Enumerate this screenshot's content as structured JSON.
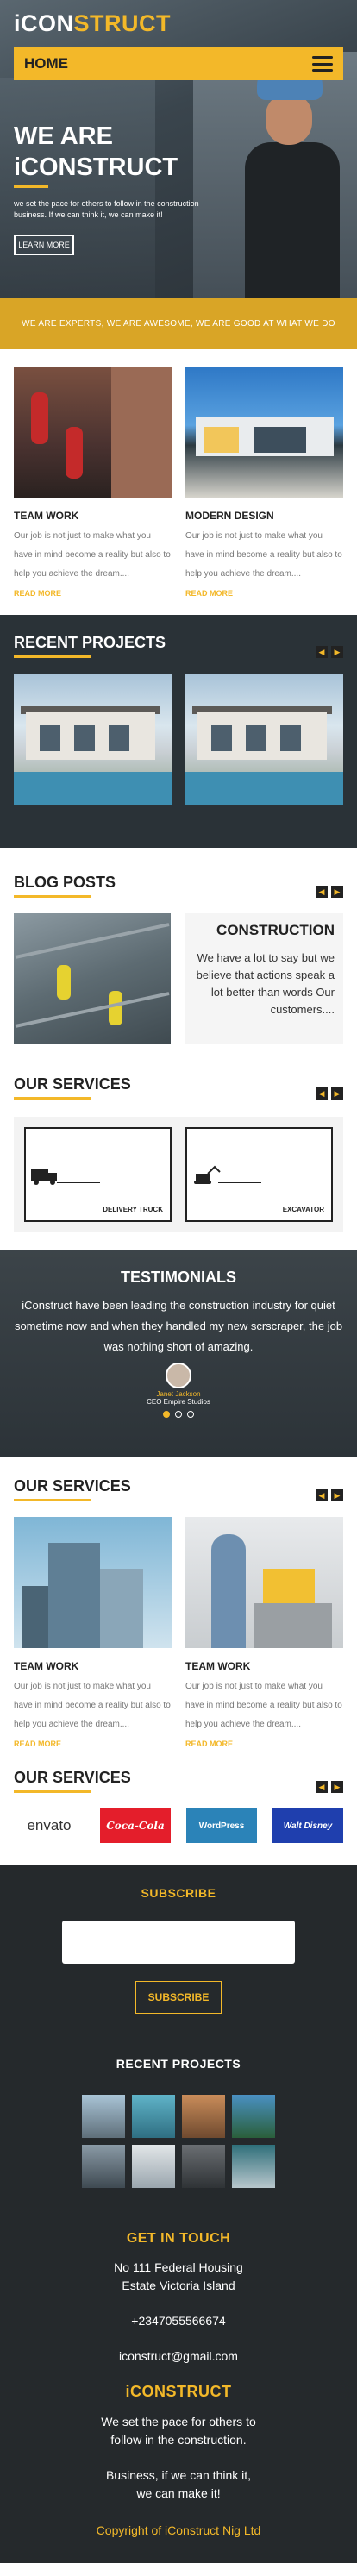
{
  "brand": {
    "prefix": "iCON",
    "suffix": "STRUCT"
  },
  "nav": {
    "home": "HOME"
  },
  "hero": {
    "title_line1": "WE ARE",
    "title_line2": "iCONSTRUCT",
    "subtitle": "we set the pace for others to follow in the construction business. If we can think it, we can make it!",
    "cta": "LEARN MORE"
  },
  "strip": {
    "text": "WE ARE EXPERTS, WE ARE AWESOME, WE ARE GOOD AT WHAT WE DO"
  },
  "features": [
    {
      "title": "TEAM WORK",
      "text": "Our job is not just to make what you have in mind become a reality but also to help you achieve the dream....",
      "link": "READ MORE"
    },
    {
      "title": "MODERN DESIGN",
      "text": "Our job is not just to make what you have in mind become a reality but also to help you achieve the dream....",
      "link": "READ MORE"
    }
  ],
  "projects": {
    "title": "RECENT PROJECTS",
    "prev": "◀",
    "next": "▶"
  },
  "blog": {
    "title": "BLOG POSTS",
    "post_title": "CONSTRUCTION",
    "post_text": "We have a lot to say but we believe that actions speak a lot better than words Our customers...."
  },
  "services": {
    "title": "OUR SERVICES",
    "items": [
      {
        "label": "DELIVERY TRUCK",
        "icon": "truck-icon"
      },
      {
        "label": "EXCAVATOR",
        "icon": "excavator-icon"
      }
    ]
  },
  "testimonials": {
    "title": "TESTIMONIALS",
    "text": "iConstruct have been leading the construction industry for quiet sometime now and when they handled my new scrscraper, the job was nothing short of amazing.",
    "name": "Janet Jackson",
    "role": "CEO Empire Studios"
  },
  "services2": {
    "title": "OUR SERVICES",
    "items": [
      {
        "title": "TEAM WORK",
        "text": "Our job is not just to make what you have in mind become a reality but also to help you achieve the dream....",
        "link": "READ MORE"
      },
      {
        "title": "TEAM WORK",
        "text": "Our job is not just to make what you have in mind become a reality but also to help you achieve the dream....",
        "link": "READ MORE"
      }
    ]
  },
  "services3": {
    "title": "OUR SERVICES",
    "logos": [
      {
        "name": "envato",
        "color": "#ffffff",
        "text_color": "#333333"
      },
      {
        "name": "Coca-Cola",
        "color": "#e41e2b",
        "text_color": "#ffffff"
      },
      {
        "name": "WordPress",
        "color": "#2b83b8",
        "text_color": "#ffffff"
      },
      {
        "name": "Walt Disney",
        "color": "#1f3fae",
        "text_color": "#ffffff"
      }
    ]
  },
  "footer": {
    "subscribe_title": "SUBSCRIBE",
    "subscribe_btn": "SUBSCRIBE",
    "recent_title": "RECENT PROJECTS",
    "contact_title": "GET IN TOUCH",
    "address_line1": "No 111 Federal Housing",
    "address_line2": "Estate Victoria Island",
    "phone": "+2347055566674",
    "email": "iconstruct@gmail.com",
    "brand": "iCONSTRUCT",
    "about_line1": "We set the pace for others to",
    "about_line2": "follow in the construction.",
    "about_line3": "Business, if we can think it,",
    "about_line4": "we can make it!",
    "copyright": "Copyright of iConstruct Nig Ltd"
  },
  "colors": {
    "accent": "#f3b829",
    "dark": "#25292c"
  }
}
